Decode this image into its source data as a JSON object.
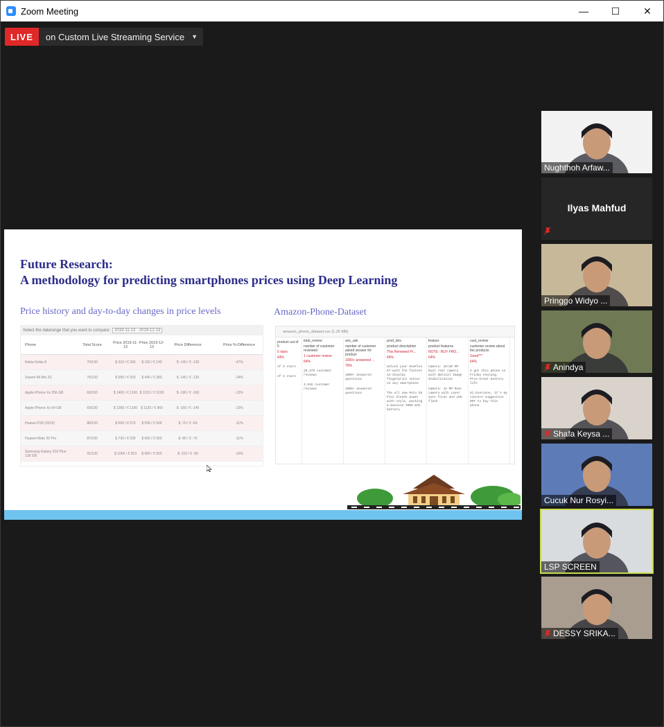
{
  "window": {
    "title": "Zoom Meeting",
    "minimize_glyph": "—",
    "maximize_glyph": "☐",
    "close_glyph": "✕"
  },
  "live": {
    "badge": "LIVE",
    "service": "on Custom Live Streaming Service"
  },
  "slide": {
    "title_line1": "Future Research:",
    "title_line2": "A methodology for predicting smartphones prices using Deep Learning",
    "left_heading": "Price history and day-to-day changes in price levels",
    "right_heading": "Amazon-Phone-Dataset",
    "price_table": {
      "range_label": "Select the daterange that you want to compare:",
      "range_value": "2019-11-13 - 2019-12-13",
      "headers": [
        "Phone",
        "Total Score",
        "Price 2019-11-13",
        "Price 2019-12-13",
        "Price Difference",
        "Price %-Difference"
      ],
      "rows": [
        [
          "Nokia Nokia 8",
          "70/100",
          "$ 310 / € 260",
          "$ 160 / € 140",
          "$ -140 / € -120",
          "-47%"
        ],
        [
          "Xiaomi Mi Mix 2S",
          "76/100",
          "$ 580 / € 500",
          "$ 440 / € 380",
          "$ -140 / € -120",
          "-24%"
        ],
        [
          "Apple iPhone Xs 256 GB",
          "69/100",
          "$ 1400 / € 1190",
          "$ 1210 / € 1030",
          "$ -190 / € -160",
          "-13%"
        ],
        [
          "Apple iPhone Xs 64 GB",
          "69/100",
          "$ 1280 / € 1100",
          "$ 1120 / € 960",
          "$ -160 / € -140",
          "-13%"
        ],
        [
          "Huawei P30 (2019)",
          "88/100",
          "$ 660 / € 570",
          "$ 590 / € 500",
          "$ -70 / € -60",
          "-11%"
        ],
        [
          "Huawei Mate 20 Pro",
          "87/100",
          "$ 730 / € 630",
          "$ 660 / € 560",
          "$ -80 / € -70",
          "-11%"
        ],
        [
          "Samsung Galaxy S10 Plus 128 GB",
          "91/100",
          "$ 1060 / € 910",
          "$ 950 / € 810",
          "$ -110 / € -90",
          "-10%"
        ]
      ]
    },
    "dataset": {
      "file": "amazon_phone_dataset.csv (1.26 MB)",
      "columns": [
        {
          "name": "",
          "desc": "product out of 5",
          "top": "5 stars",
          "pct": "64%",
          "cells": [
            "of 5 stars",
            "of 5 stars"
          ]
        },
        {
          "name": "total_review",
          "desc": "number of customer reviewed",
          "top": "1 customer review",
          "pct": "64%",
          "cells": [
            "20,376 customer reviews",
            "3,818 customer reviews"
          ]
        },
        {
          "name": "ans_ask",
          "desc": "number of customer asked answer for product",
          "top": "1000+ answered ...",
          "pct": "76%",
          "cells": [
            "1000+ answered questions",
            "1000+ answered questions"
          ]
        },
        {
          "name": "prod_des",
          "desc": "product description",
          "top": "This Renewed Pr...",
          "pct": "64%",
          "cells": [
            "Unlock your OnePlus 6T with the fastest in-display fingerprint sensor on any smartphone",
            "The all new Moto G5 Plus blends power with style, packing a massive 3000 mAh battery"
          ]
        },
        {
          "name": "feature",
          "desc": "product features",
          "top": "NOTE : BUY FRO...",
          "pct": "64%",
          "cells": [
            "Camera: 16+20 MP Dual rear camera with Optical Image Stabilization",
            "Camera: 12 MP Rear camera with Laser auto focus and LED flash"
          ]
        },
        {
          "name": "cust_review",
          "desc": "customer review about the products",
          "top": "Good***",
          "pct": "64%",
          "cells": [
            "I got this phone on Friday evening. Pros-Great battery life",
            "Hi Everyone, It's my sincere suggestion NOT to buy this phone"
          ]
        }
      ]
    }
  },
  "participants": [
    {
      "name": "Nughthoh Arfaw...",
      "video": true,
      "muted": false,
      "bg": "#f2f2f2"
    },
    {
      "name": "Ilyas Mahfud",
      "video": false,
      "muted": true,
      "bg": "#262626"
    },
    {
      "name": "Pringgo Widyo ...",
      "video": true,
      "muted": false,
      "bg": "#c7b89a"
    },
    {
      "name": "Anindya",
      "video": true,
      "muted": true,
      "bg": "#6f7a55"
    },
    {
      "name": "Shafa Keysa ...",
      "video": true,
      "muted": true,
      "bg": "#d9d3cc"
    },
    {
      "name": "Cucuk Nur Rosyi...",
      "video": true,
      "muted": false,
      "bg": "#5d7bb7"
    },
    {
      "name": "LSP SCREEN",
      "video": true,
      "muted": false,
      "active": true,
      "bg": "#d8dcdf"
    },
    {
      "name": "DESSY SRIKA...",
      "video": true,
      "muted": true,
      "bg": "#a89d8f"
    }
  ],
  "colors": {
    "live_red": "#e02828",
    "slide_title": "#2b2b8a",
    "slide_heading": "#6a67c7",
    "footer_blue": "#6ec4ef",
    "active_border": "#c9dc4e",
    "mute_red": "#e02828"
  },
  "icons": [
    "zoom-app-icon",
    "minimize-icon",
    "maximize-icon",
    "close-icon",
    "chevron-down-icon",
    "mic-muted-icon",
    "mouse-cursor-icon"
  ]
}
